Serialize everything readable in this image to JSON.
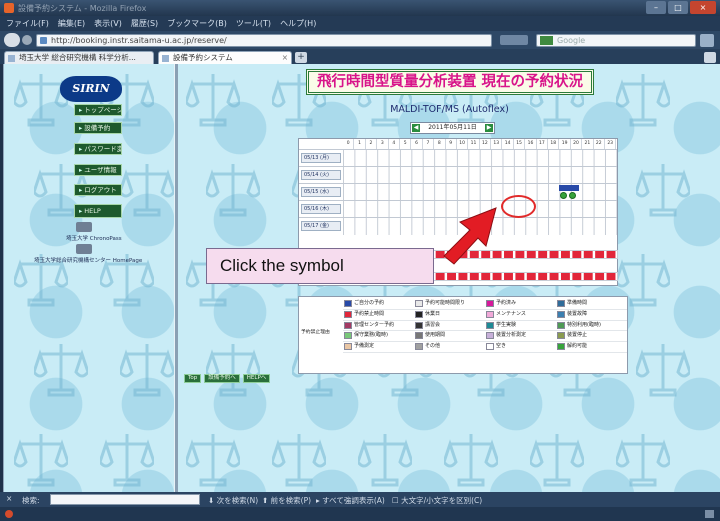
{
  "window": {
    "title": "設備予約システム - Mozilla Firefox",
    "controls": [
      "–",
      "□",
      "×"
    ]
  },
  "menu": [
    "ファイル(F)",
    "編集(E)",
    "表示(V)",
    "履歴(S)",
    "ブックマーク(B)",
    "ツール(T)",
    "ヘルプ(H)"
  ],
  "nav": {
    "url": "http://booking.instr.saitama-u.ac.jp/reserve/",
    "search_placeholder": "Google"
  },
  "tabs": [
    {
      "label": "埼玉大学 総合研究機構 科学分析..."
    },
    {
      "label": "設備予約システム"
    }
  ],
  "left_nav": {
    "logo": "SIRIN",
    "buttons": [
      "トップページ",
      "設備予約",
      "パスワード変更",
      "ユーザ情報",
      "ログアウト",
      "HELP"
    ],
    "links": [
      "埼玉大学 ChronoPass",
      "埼玉大学総合研究機構センター HomePage"
    ]
  },
  "main": {
    "title": "飛行時間型質量分析装置 現在の予約状況",
    "instrument": "MALDI-TOF/MS (Autoflex)",
    "date_selector": "2011年05月11日",
    "hours": [
      "0",
      "1",
      "2",
      "3",
      "4",
      "5",
      "6",
      "7",
      "8",
      "9",
      "10",
      "11",
      "12",
      "13",
      "14",
      "15",
      "16",
      "17",
      "18",
      "19",
      "20",
      "21",
      "22",
      "23"
    ],
    "days": [
      "05/13 (月)",
      "05/14 (火)",
      "05/15 (水)",
      "05/16 (木)",
      "05/17 (金)"
    ],
    "legend_side_label": "予約禁止理由",
    "legend": [
      {
        "label": "ご自分の予約",
        "color": "#284aa8"
      },
      {
        "label": "予約可能時間限り",
        "color": "#e8e8e8"
      },
      {
        "label": "予約済み",
        "color": "#d6199b"
      },
      {
        "label": "準備時間",
        "color": "#2f6c9a"
      },
      {
        "label": "予約禁止時間",
        "color": "#e2263a"
      },
      {
        "label": "休業日",
        "color": "#222222"
      },
      {
        "label": "メンテナンス",
        "color": "#f1a9d8"
      },
      {
        "label": "装置故障",
        "color": "#3b7fb0"
      },
      {
        "label": "管理センター予約",
        "color": "#a43a64"
      },
      {
        "label": "講習会",
        "color": "#333333"
      },
      {
        "label": "学生実験",
        "color": "#1e8a95"
      },
      {
        "label": "特別利用(臨時)",
        "color": "#4f9a55"
      },
      {
        "label": "保守業務(臨時)",
        "color": "#79c779"
      },
      {
        "label": "使用期間",
        "color": "#777777"
      },
      {
        "label": "装置分析測定",
        "color": "#c7b0d9"
      },
      {
        "label": "装置停止",
        "color": "#8a9b50"
      },
      {
        "label": "予備測定",
        "color": "#e9c6a4"
      },
      {
        "label": "その他",
        "color": "#a0a0a0"
      },
      {
        "label": "空き",
        "color": "#ffffff"
      },
      {
        "label": "解約可能",
        "color": "#37a33b"
      }
    ],
    "bottom_buttons": [
      "Top",
      "設備予約へ",
      "HELPへ"
    ]
  },
  "annotation": {
    "callout": "Click the symbol"
  },
  "findbar": {
    "label": "検索:",
    "next": "次を検索(N)",
    "prev": "前を検索(P)",
    "highlight": "すべて強調表示(A)",
    "match_case": "大文字/小文字を区別(C)"
  }
}
